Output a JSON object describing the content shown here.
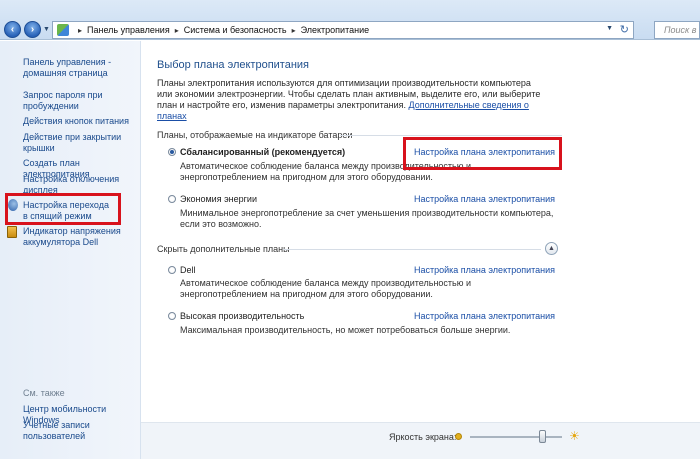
{
  "address_bar": {
    "segments": [
      "Панель управления",
      "Система и безопасность",
      "Электропитание"
    ],
    "search_placeholder": "Поиск в панели"
  },
  "sidebar": {
    "home": "Панель управления - домашняя страница",
    "items": [
      "Запрос пароля при пробуждении",
      "Действия кнопок питания",
      "Действие при закрытии крышки",
      "Создать план электропитания",
      "Настройка отключения дисплея",
      "Настройка перехода в спящий режим",
      "Индикатор напряжения аккумулятора Dell"
    ],
    "see_also": "См. также",
    "see_also_items": [
      "Центр мобильности Windows",
      "Учетные записи пользователей"
    ]
  },
  "main": {
    "title": "Выбор плана электропитания",
    "intro": "Планы электропитания используются для оптимизации производительности компьютера или экономии электроэнергии. Чтобы сделать план активным, выделите его, или выберите план и настройте его, изменив параметры электропитания. ",
    "intro_link": "Дополнительные сведения о планах",
    "section_battery": "Планы, отображаемые на индикаторе батареи",
    "section_hidden": "Скрыть дополнительные планы",
    "plan_link": "Настройка плана электропитания",
    "plans": [
      {
        "name": "Сбалансированный (рекомендуется)",
        "desc": "Автоматическое соблюдение баланса между производительностью и энергопотреблением на пригодном для этого оборудовании.",
        "selected": true
      },
      {
        "name": "Экономия энергии",
        "desc": "Минимальное энергопотребление за счет уменьшения производительности компьютера, если это возможно.",
        "selected": false
      },
      {
        "name": "Dell",
        "desc": "Автоматическое соблюдение баланса между производительностью и энергопотреблением на пригодном для этого оборудовании.",
        "selected": false
      },
      {
        "name": "Высокая производительность",
        "desc": "Максимальная производительность, но может потребоваться больше энергии.",
        "selected": false
      }
    ]
  },
  "status": {
    "brightness_label": "Яркость экрана:",
    "brightness_level": 0.78
  },
  "colors": {
    "highlight": "#d8121c",
    "link": "#1a4ea6"
  }
}
